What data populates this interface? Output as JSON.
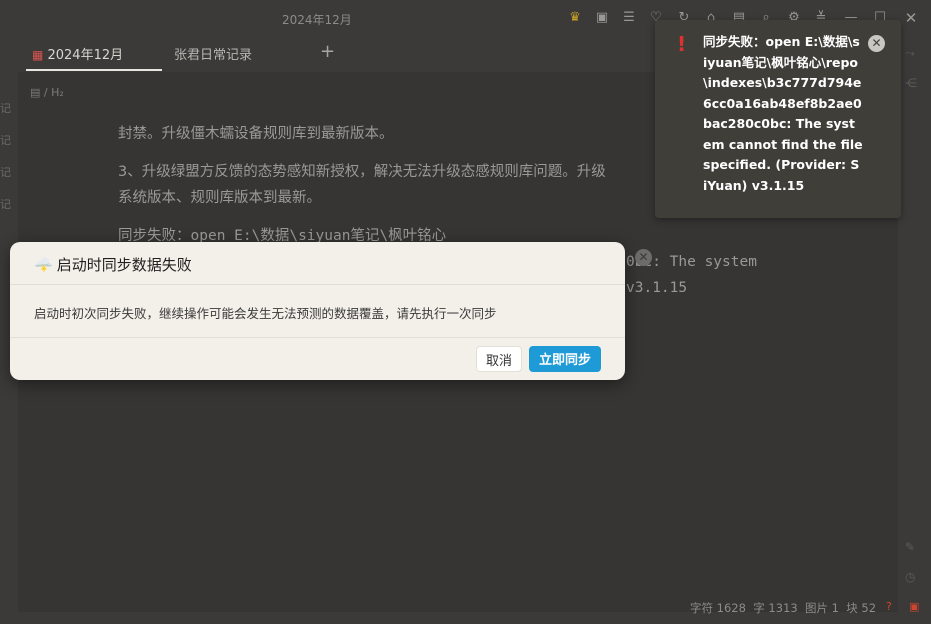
{
  "window": {
    "title": "2024年12月",
    "toolbar_icons": [
      "crown-icon",
      "book-icon",
      "list-icon",
      "bulb-icon",
      "refresh-icon",
      "home-icon",
      "terminal-icon",
      "search-icon",
      "settings-icon",
      "sliders-icon",
      "minimize-icon",
      "maximize-icon",
      "close-icon"
    ]
  },
  "tabs": [
    {
      "label": "2024年12月",
      "active": true
    },
    {
      "label": "张君日常记录",
      "active": false
    }
  ],
  "breadcrumb": {
    "separator": "/",
    "heading": "H₂"
  },
  "editor": {
    "line1": "封禁。升级僵木蠕设备规则库到最新版本。",
    "line2a": "3、升级绿盟方反馈的态势感知新授权，解决无法升级态感规则库问题。升级",
    "line2b": "系统版本、规则库版本到最新。",
    "line3": "同步失败：open E:\\数据\\siyuan笔记\\枫叶铭心",
    "line4_tail": "0bc: The system",
    "line5_tail": "v3.1.15"
  },
  "toast": {
    "message": "同步失败：open E:\\数据\\siyuan笔记\\枫叶铭心\\repo\\indexes\\b3c777d794e6cc0a16ab48ef8b2ae0bac280c0bc: The system cannot find the file specified. (Provider: SiYuan) v3.1.15"
  },
  "dialog": {
    "emoji": "🌩️",
    "title": "启动时同步数据失败",
    "body": "启动时初次同步失败，继续操作可能会发生无法预测的数据覆盖，请先执行一次同步",
    "cancel_label": "取消",
    "confirm_label": "立即同步"
  },
  "statusbar": {
    "chars": "字符 1628",
    "words": "字 1313",
    "images": "图片 1",
    "blocks": "块 52"
  }
}
